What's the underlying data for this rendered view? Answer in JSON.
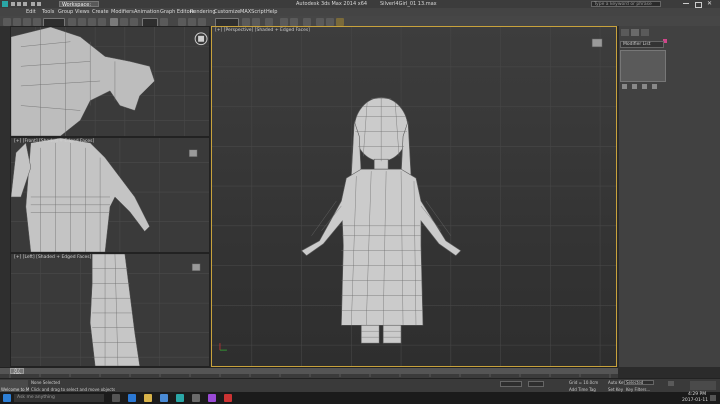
{
  "titlebar": {
    "title": "Autodesk 3ds Max 2014 x64",
    "file": "Silverl4Girl_01 13.max",
    "workspace": "Workspace: Default",
    "search_placeholder": "Type a keyword or phrase"
  },
  "menu": {
    "items": [
      "Edit",
      "Tools",
      "Group",
      "Views",
      "Create",
      "Modifiers",
      "Animation",
      "Graph Editors",
      "Rendering",
      "Customize",
      "MAXScript",
      "Help"
    ]
  },
  "viewports": {
    "top_left_label": "",
    "mid_left_label": "[+] [Front] [Shaded + Edged Faces]",
    "bottom_left_label": "[+] [Left] [Shaded + Edged Faces]",
    "main_label": "[+] [Perspective] [Shaded + Edged Faces]"
  },
  "command_panel": {
    "modifier_list": "Modifier List"
  },
  "timeline": {
    "frame": "0 / 100",
    "ticks": [
      "0",
      "5",
      "10",
      "15",
      "20",
      "25",
      "30",
      "35",
      "40",
      "45",
      "50",
      "55",
      "60",
      "65",
      "70",
      "75",
      "80",
      "85",
      "90",
      "95",
      "100"
    ]
  },
  "status": {
    "welcome": "Welcome to M",
    "selected": "None Selected",
    "prompt": "Click and drag to select and move objects",
    "grid": "Grid = 10.0cm",
    "add_time_tag": "Add Time Tag",
    "auto_key": "Auto Key",
    "set_key": "Set Key",
    "key_filters": "Key Filters...",
    "selected_dd": "Selected"
  },
  "taskbar": {
    "search_placeholder": "Ask me anything",
    "time": "4:29 PM",
    "date": "2017-01-11"
  },
  "colors": {
    "accent_pink": "#d0468a",
    "active_border": "#c8a23c"
  }
}
